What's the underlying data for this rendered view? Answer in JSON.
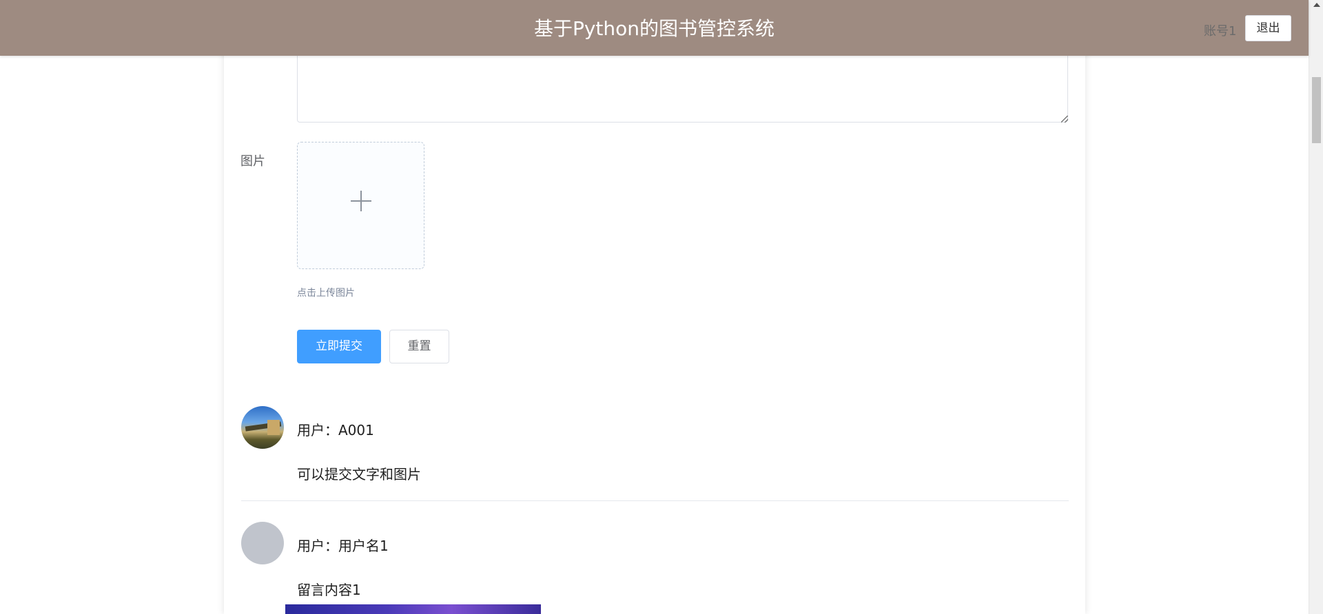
{
  "header": {
    "title": "基于Python的图书管控系统",
    "account": "账号1",
    "logout_label": "退出",
    "bg_color": "#9e8b81"
  },
  "form": {
    "image_label": "图片",
    "upload_tip": "点击上传图片",
    "submit_label": "立即提交",
    "reset_label": "重置",
    "textarea_value": "",
    "submit_color": "#409eff"
  },
  "comments": [
    {
      "user": "用户：A001",
      "content": "可以提交文字和图片",
      "avatar": "photo"
    },
    {
      "user": "用户：用户名1",
      "content": "留言内容1",
      "avatar": "placeholder"
    }
  ]
}
